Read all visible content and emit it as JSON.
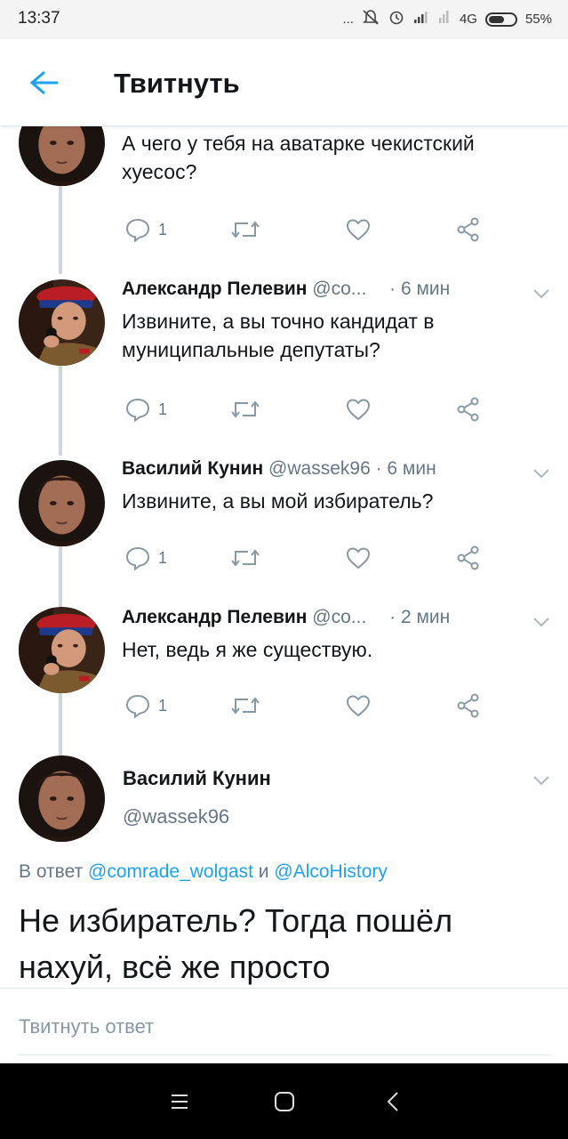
{
  "status_bar": {
    "time": "13:37",
    "signal_text": "...",
    "network": "4G",
    "battery": "55%",
    "icons": [
      "mute-icon",
      "alarm-icon",
      "signal-icon",
      "signal-icon",
      "battery-icon"
    ]
  },
  "header": {
    "back_icon": "arrow-left-icon",
    "title": "Твитнуть"
  },
  "tweets": [
    {
      "name": "",
      "handle": "",
      "time": "",
      "text": "А чего у тебя на аватарке чекистский хуесос?",
      "reply_count": "1",
      "avatar": "kunin"
    },
    {
      "name": "Александр Пелевин",
      "handle": "@co...",
      "time": "· 6 мин",
      "text": "Извините, а вы точно кандидат в муниципальные депутаты?",
      "reply_count": "1",
      "avatar": "pelevin"
    },
    {
      "name": "Василий Кунин",
      "handle": "@wassek96",
      "time": "· 6 мин",
      "text": "Извините, а вы мой избиратель?",
      "reply_count": "1",
      "avatar": "kunin"
    },
    {
      "name": "Александр Пелевин",
      "handle": "@co...",
      "time": "· 2 мин",
      "text": "Нет, ведь я же существую.",
      "reply_count": "1",
      "avatar": "pelevin"
    }
  ],
  "focus_tweet": {
    "name": "Василий Кунин",
    "handle": "@wassek96",
    "reply_prefix": "В ответ",
    "mention_1": "@comrade_wolgast",
    "mention_joiner": "и",
    "mention_2": "@AlcoHistory",
    "text": "Не избиратель? Тогда пошёл нахуй, всё же просто"
  },
  "reply_bar": {
    "placeholder": "Твитнуть ответ"
  },
  "colors": {
    "accent": "#1da1f2",
    "secondary_text": "#657786",
    "thread_line": "#ccd6dd",
    "icon_gray": "#8899a6"
  }
}
